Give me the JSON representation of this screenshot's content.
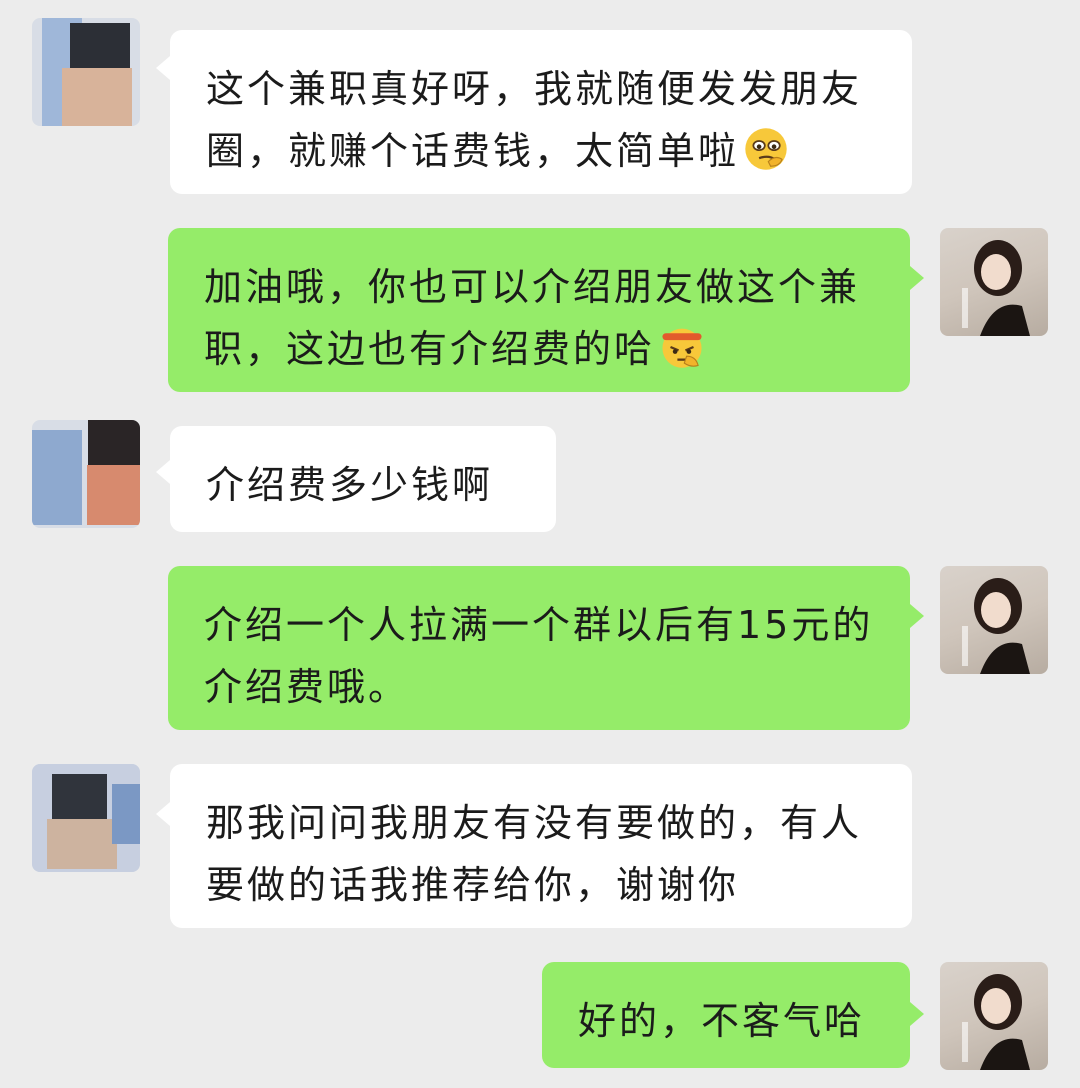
{
  "messages": [
    {
      "side": "left",
      "text": "这个兼职真好呀，我就随便发发朋友圈，就赚个话费钱，太简单啦",
      "emoji": "thinking-face-icon"
    },
    {
      "side": "right",
      "text": "加油哦，你也可以介绍朋友做这个兼职，这边也有介绍费的哈",
      "emoji": "fighting-face-icon"
    },
    {
      "side": "left",
      "text": "介绍费多少钱啊",
      "emoji": ""
    },
    {
      "side": "right",
      "text": "介绍一个人拉满一个群以后有15元的介绍费哦。",
      "emoji": ""
    },
    {
      "side": "left",
      "text": "那我问问我朋友有没有要做的，有人要做的话我推荐给你，谢谢你",
      "emoji": ""
    },
    {
      "side": "right",
      "text": "好的，不客气哈",
      "emoji": ""
    }
  ],
  "colors": {
    "background": "#ececec",
    "left_bubble": "#ffffff",
    "right_bubble": "#95ec69"
  }
}
